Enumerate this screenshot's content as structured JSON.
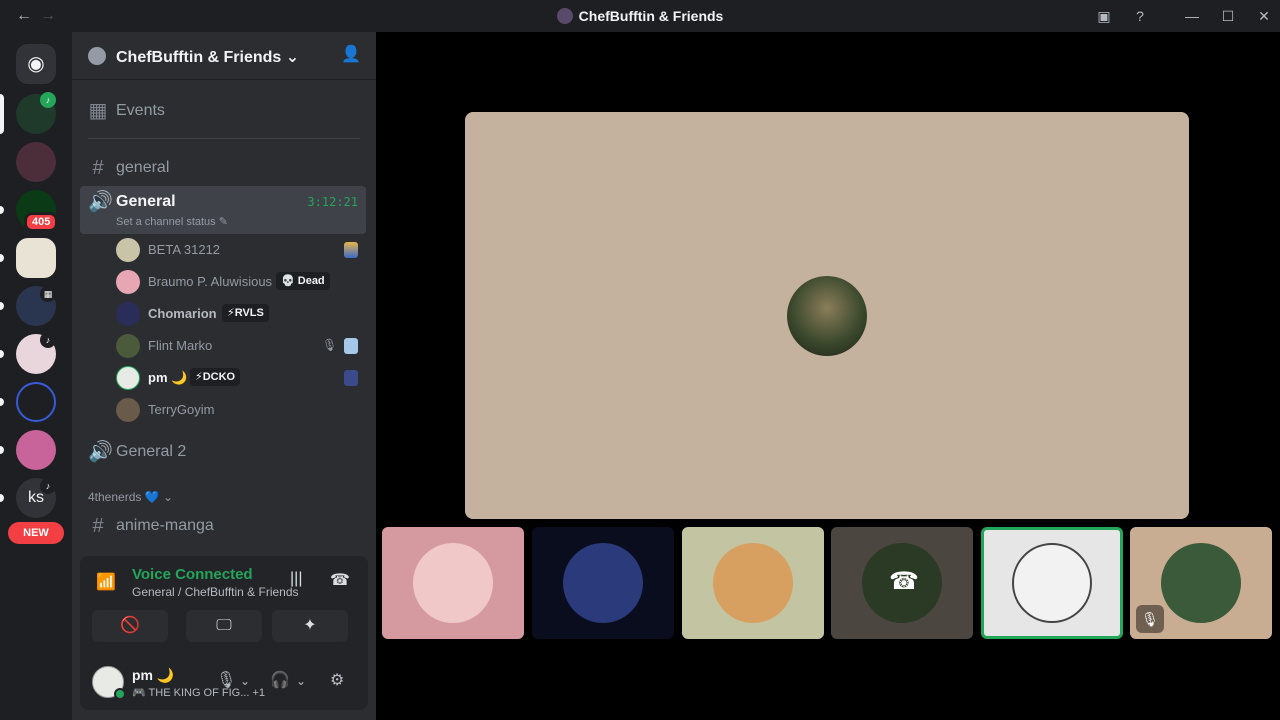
{
  "window": {
    "title": "ChefBufftin & Friends",
    "back_icon": "arrow-left-icon",
    "forward_icon": "arrow-right-icon"
  },
  "rail": {
    "badge_count": "405",
    "new_label": "NEW",
    "ks_label": "ks"
  },
  "sidebar": {
    "server_name": "ChefBufftin & Friends",
    "events_label": "Events",
    "channels": {
      "general_text": "general",
      "general_voice": "General",
      "general_voice_timer": "3:12:21",
      "general_voice_status": "Set a channel status",
      "general2": "General 2",
      "anime": "anime-manga"
    },
    "voice_users": [
      {
        "name": "BETA 31212",
        "tag": ""
      },
      {
        "name": "Braumo P. Aluwisious",
        "tag": "💀 Dead"
      },
      {
        "name": "Chomarion",
        "tag": "⚡RVLS"
      },
      {
        "name": "Flint Marko",
        "tag": ""
      },
      {
        "name": "pm 🌙",
        "tag": "⚡DCKO"
      },
      {
        "name": "TerryGoyim",
        "tag": ""
      }
    ],
    "category": "4thenerds 💙"
  },
  "voice_panel": {
    "title": "Voice Connected",
    "subtitle": "General / ChefBufftin & Friends"
  },
  "user_area": {
    "name": "pm 🌙",
    "status": "🎮 THE KING OF FIG...",
    "extra": "+1"
  },
  "colors": {
    "accent_green": "#23a55a",
    "danger_red": "#f23f43",
    "main_tile_bg": "#c4b29e"
  }
}
